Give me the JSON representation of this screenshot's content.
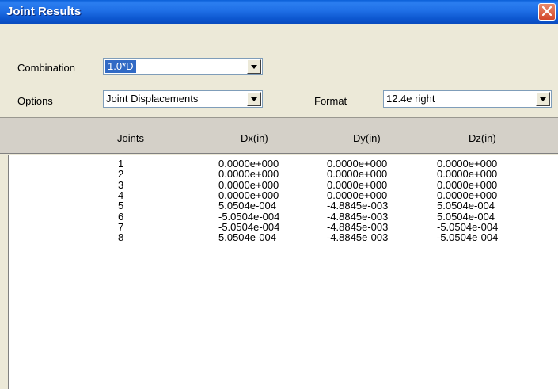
{
  "window": {
    "title": "Joint Results"
  },
  "controls": {
    "combination_label": "Combination",
    "combination_value": "1.0*D",
    "options_label": "Options",
    "options_value": "Joint Displacements",
    "format_label": "Format",
    "format_value": "12.4e right"
  },
  "table": {
    "columns": [
      "Joints",
      "Dx(in)",
      "Dy(in)",
      "Dz(in)"
    ],
    "rows": [
      [
        "1",
        "0.0000e+000",
        "0.0000e+000",
        "0.0000e+000"
      ],
      [
        "2",
        "0.0000e+000",
        "0.0000e+000",
        "0.0000e+000"
      ],
      [
        "3",
        "0.0000e+000",
        "0.0000e+000",
        "0.0000e+000"
      ],
      [
        "4",
        "0.0000e+000",
        "0.0000e+000",
        "0.0000e+000"
      ],
      [
        "5",
        "5.0504e-004",
        "-4.8845e-003",
        "5.0504e-004"
      ],
      [
        "6",
        "-5.0504e-004",
        "-4.8845e-003",
        "5.0504e-004"
      ],
      [
        "7",
        "-5.0504e-004",
        "-4.8845e-003",
        "-5.0504e-004"
      ],
      [
        "8",
        "5.0504e-004",
        "-4.8845e-003",
        "-5.0504e-004"
      ]
    ]
  },
  "icons": {
    "close": "close-icon",
    "dropdown": "chevron-down-icon"
  },
  "colors": {
    "titlebar": "#0a5fd8",
    "selection": "#316ac5",
    "close": "#d3472a"
  }
}
